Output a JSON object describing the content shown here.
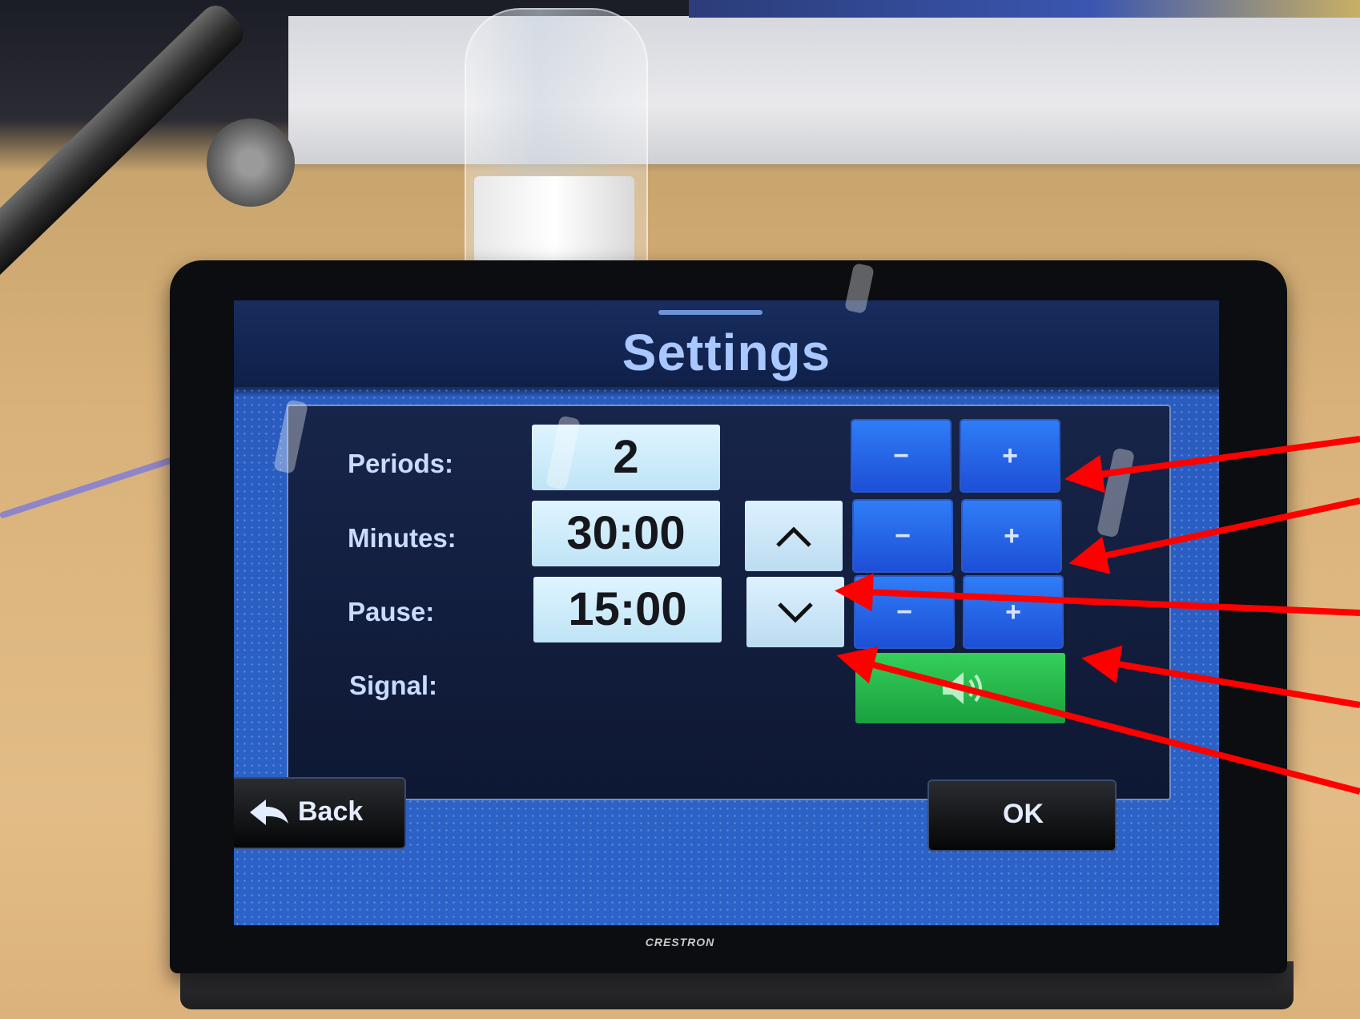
{
  "screen": {
    "title": "Settings",
    "rows": [
      {
        "label": "Periods:",
        "value": "2"
      },
      {
        "label": "Minutes:",
        "value": "30:00"
      },
      {
        "label": "Pause:",
        "value": "15:00"
      },
      {
        "label": "Signal:"
      }
    ],
    "minus_label": "−",
    "plus_label": "+",
    "back_label": "Back",
    "ok_label": "OK"
  },
  "device_brand": "CRESTRON",
  "colors": {
    "accent_blue": "#2f7df7",
    "signal_green": "#35cf5a",
    "annotation_arrow": "#ff0000"
  },
  "icons": [
    "chevron-up-icon",
    "chevron-down-icon",
    "speaker-icon",
    "back-arrow-icon"
  ]
}
